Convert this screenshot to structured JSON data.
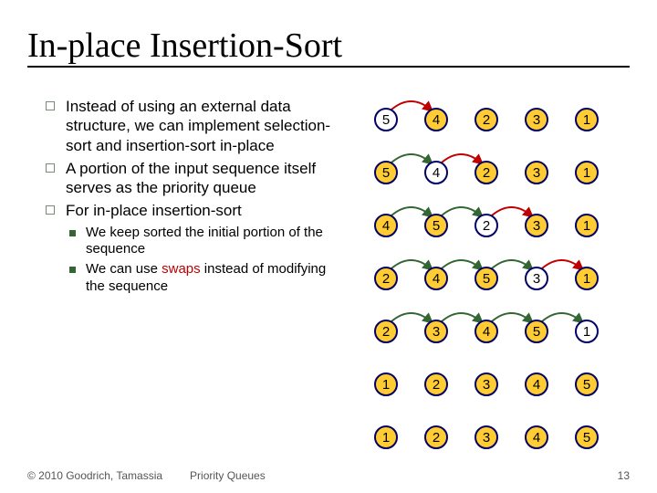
{
  "title": "In-place Insertion-Sort",
  "bullets": {
    "b1": "Instead of using an external data structure, we can implement selection-sort and insertion-sort in-place",
    "b2": "A portion of the input sequence itself serves as the priority queue",
    "b3": "For in-place insertion-sort",
    "b3a": "We keep sorted the initial portion of the sequence",
    "b3b_prefix": "We can use ",
    "b3b_red": "swaps",
    "b3b_suffix": " instead of modifying the sequence"
  },
  "footer": {
    "copyright": "© 2010 Goodrich, Tamassia",
    "section": "Priority Queues",
    "page": "13"
  },
  "rows": [
    {
      "vals": [
        "5",
        "4",
        "2",
        "3",
        "1"
      ],
      "styles": [
        "o",
        "f",
        "f",
        "f",
        "f"
      ],
      "arcs": [
        {
          "from": 0,
          "to": 1,
          "color": "#c00000"
        }
      ]
    },
    {
      "vals": [
        "5",
        "4",
        "2",
        "3",
        "1"
      ],
      "styles": [
        "f",
        "o",
        "f",
        "f",
        "f"
      ],
      "arcs": [
        {
          "from": 0,
          "to": 1,
          "color": "#336633"
        },
        {
          "from": 1,
          "to": 2,
          "color": "#c00000"
        }
      ]
    },
    {
      "vals": [
        "4",
        "5",
        "2",
        "3",
        "1"
      ],
      "styles": [
        "f",
        "f",
        "o",
        "f",
        "f"
      ],
      "arcs": [
        {
          "from": 0,
          "to": 1,
          "color": "#336633"
        },
        {
          "from": 1,
          "to": 2,
          "color": "#336633"
        },
        {
          "from": 2,
          "to": 3,
          "color": "#c00000"
        }
      ]
    },
    {
      "vals": [
        "2",
        "4",
        "5",
        "3",
        "1"
      ],
      "styles": [
        "f",
        "f",
        "f",
        "o",
        "f"
      ],
      "arcs": [
        {
          "from": 0,
          "to": 1,
          "color": "#336633"
        },
        {
          "from": 1,
          "to": 2,
          "color": "#336633"
        },
        {
          "from": 2,
          "to": 3,
          "color": "#336633"
        },
        {
          "from": 3,
          "to": 4,
          "color": "#c00000"
        }
      ]
    },
    {
      "vals": [
        "2",
        "3",
        "4",
        "5",
        "1"
      ],
      "styles": [
        "f",
        "f",
        "f",
        "f",
        "o"
      ],
      "arcs": [
        {
          "from": 0,
          "to": 1,
          "color": "#336633"
        },
        {
          "from": 1,
          "to": 2,
          "color": "#336633"
        },
        {
          "from": 2,
          "to": 3,
          "color": "#336633"
        },
        {
          "from": 3,
          "to": 4,
          "color": "#336633"
        }
      ]
    },
    {
      "vals": [
        "1",
        "2",
        "3",
        "4",
        "5"
      ],
      "styles": [
        "f",
        "f",
        "f",
        "f",
        "f"
      ],
      "arcs": []
    },
    {
      "vals": [
        "1",
        "2",
        "3",
        "4",
        "5"
      ],
      "styles": [
        "f",
        "f",
        "f",
        "f",
        "f"
      ],
      "arcs": []
    }
  ]
}
